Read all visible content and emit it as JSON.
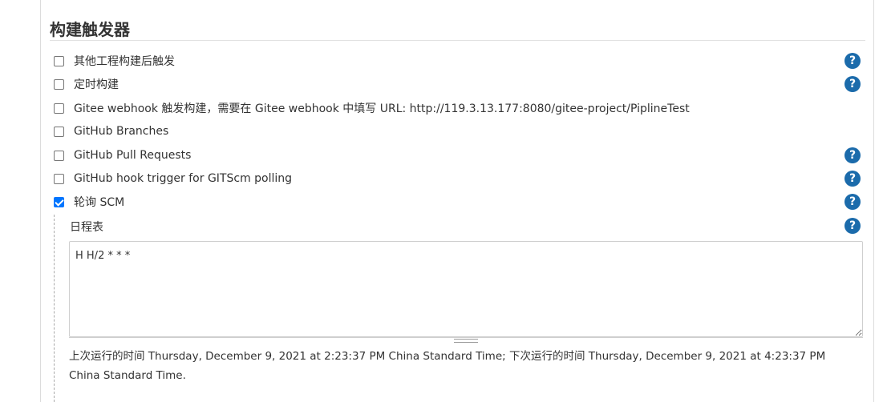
{
  "section": {
    "title": "构建触发器"
  },
  "triggers": [
    {
      "label": "其他工程构建后触发",
      "checked": false,
      "has_help": true
    },
    {
      "label": "定时构建",
      "checked": false,
      "has_help": true
    },
    {
      "label": "Gitee webhook 触发构建，需要在 Gitee webhook 中填写 URL: http://119.3.13.177:8080/gitee-project/PiplineTest",
      "checked": false,
      "has_help": false
    },
    {
      "label": "GitHub Branches",
      "checked": false,
      "has_help": false
    },
    {
      "label": "GitHub Pull Requests",
      "checked": false,
      "has_help": true
    },
    {
      "label": "GitHub hook trigger for GITScm polling",
      "checked": false,
      "has_help": true
    },
    {
      "label": "轮询 SCM",
      "checked": true,
      "has_help": true
    }
  ],
  "schedule": {
    "label": "日程表",
    "value": "H H/2 * * *",
    "info": "上次运行的时间 Thursday, December 9, 2021 at 2:23:37 PM China Standard Time; 下次运行的时间 Thursday, December 9, 2021 at 4:23:37 PM China Standard Time."
  },
  "icons": {
    "help": "help-icon",
    "checkbox": "checkbox"
  },
  "colors": {
    "help_icon": "#1b6bab",
    "checkbox_checked": "#0075ff"
  },
  "help_glyph": "?"
}
